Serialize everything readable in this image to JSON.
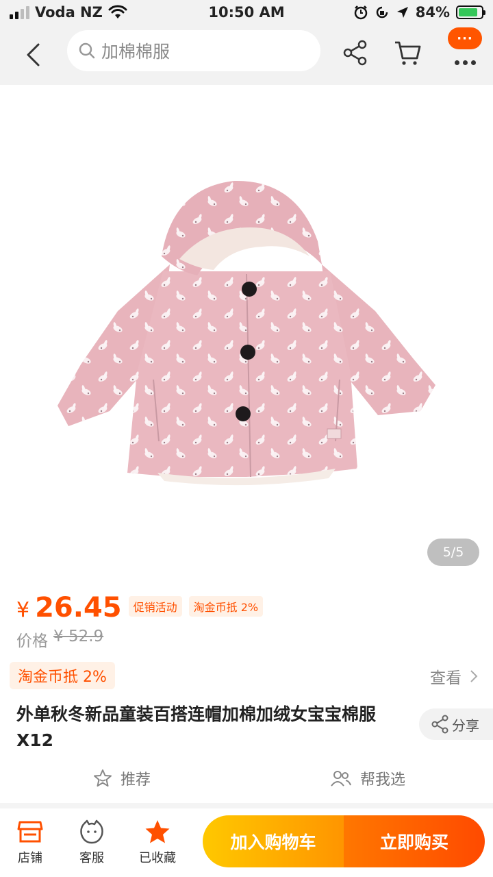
{
  "status_bar": {
    "carrier": "Voda NZ",
    "time": "10:50 AM",
    "battery": "84%"
  },
  "header": {
    "search_text": "加棉棉服",
    "more_badge": "···"
  },
  "gallery": {
    "counter": "5/5"
  },
  "price": {
    "currency": "¥",
    "current": "26.45",
    "promo_tag": "促销活动",
    "coin_tag": "淘金币抵 2%",
    "original_label": "价格",
    "original_price": "¥ 52.9"
  },
  "coin_row": {
    "badge": "淘金币抵 2%",
    "view": "查看"
  },
  "product": {
    "title": "外单秋冬新品童装百搭连帽加棉加绒女宝宝棉服 X12",
    "share": "分享"
  },
  "actions": {
    "recommend": "推荐",
    "help_choose": "帮我选"
  },
  "bottom_bar": {
    "shop": "店铺",
    "service": "客服",
    "favorited": "已收藏",
    "add_to_cart": "加入购物车",
    "buy_now": "立即购买"
  },
  "colors": {
    "accent": "#ff5000",
    "cart_gradient_start": "#ffc800",
    "buy_gradient_end": "#ff4a00"
  }
}
